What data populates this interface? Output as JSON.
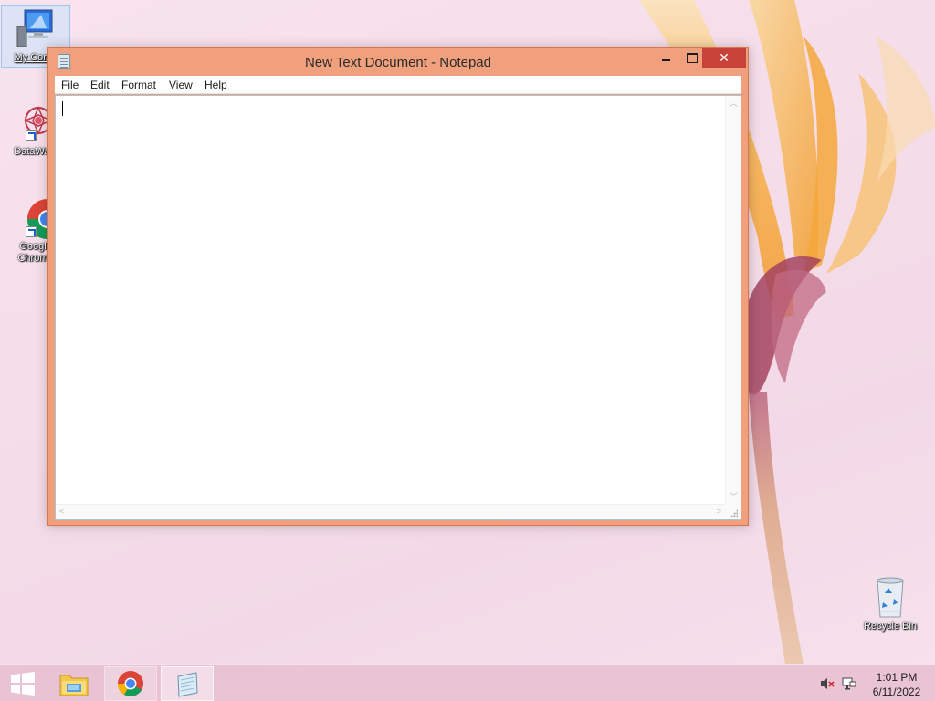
{
  "desktop": {
    "icons": [
      {
        "label": "My Comp"
      },
      {
        "label": "DataWag"
      },
      {
        "label": "Googl Chrom"
      },
      {
        "label": "Recycle Bin"
      }
    ]
  },
  "window": {
    "title": "New Text Document - Notepad",
    "close_glyph": "✕",
    "menu": [
      "File",
      "Edit",
      "Format",
      "View",
      "Help"
    ],
    "content": ""
  },
  "taskbar": {
    "items": [
      "start-button",
      "file-explorer",
      "google-chrome",
      "notepad"
    ],
    "clock": {
      "time": "1:01 PM",
      "date": "6/11/2022"
    },
    "tray": [
      "volume-muted-icon",
      "network-icon"
    ]
  },
  "colors": {
    "window_frame": "#f0a07c",
    "close_button": "#c7433a",
    "taskbar": "#e8c1d1"
  }
}
